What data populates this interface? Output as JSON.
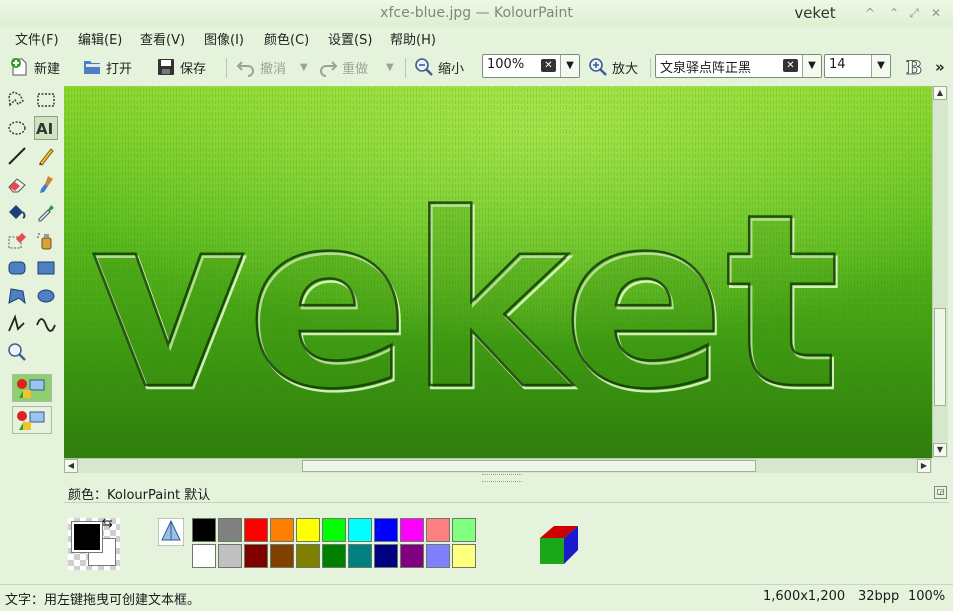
{
  "window": {
    "title": "xfce-blue.jpg — KolourPaint",
    "host": "veket",
    "controls": [
      "^",
      "⌃",
      "⤢",
      "✕"
    ]
  },
  "menu": [
    "文件(F)",
    "编辑(E)",
    "查看(V)",
    "图像(I)",
    "颜色(C)",
    "设置(S)",
    "帮助(H)"
  ],
  "toolbar": {
    "new_label": "新建",
    "open_label": "打开",
    "save_label": "保存",
    "undo_label": "撤消",
    "redo_label": "重做",
    "zoom_out_label": "缩小",
    "zoom_value": "100%",
    "zoom_in_label": "放大",
    "font_value": "文泉驿点阵正黑",
    "font_size_value": "14",
    "more_label": "»"
  },
  "tools": [
    "free-select",
    "rect-select",
    "ellipse-select",
    "text",
    "line",
    "pen",
    "eraser",
    "brush",
    "flood-fill",
    "color-picker",
    "color-eraser",
    "spraycan",
    "rounded-rect",
    "rectangle",
    "polygon",
    "ellipse",
    "connected-lines",
    "curve",
    "zoom"
  ],
  "canvas": {
    "text": "veket"
  },
  "colorbox": {
    "title": "颜色：KolourPaint 默认",
    "foreground": "#000000",
    "background": "#ffffff",
    "palette_row1": [
      "#000000",
      "#808080",
      "#ff0000",
      "#ff8000",
      "#ffff00",
      "#00ff00",
      "#00ffff",
      "#0000ff",
      "#ff00ff",
      "#ff8080",
      "#80ff80"
    ],
    "palette_row2": [
      "#ffffff",
      "#c0c0c0",
      "#800000",
      "#804000",
      "#808000",
      "#008000",
      "#008080",
      "#000080",
      "#800080",
      "#8080ff",
      "#ffff80"
    ]
  },
  "status": {
    "hint": "文字：用左键拖曳可创建文本框。",
    "dimensions": "1,600x1,200",
    "depth": "32bpp",
    "zoom": "100%"
  }
}
